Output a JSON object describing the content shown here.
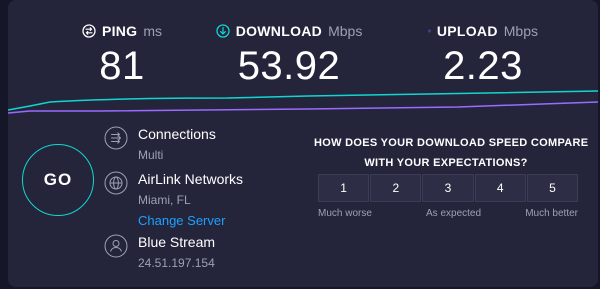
{
  "colors": {
    "background": "#151628",
    "panel": "#24253b",
    "accent_cyan": "#11d6d0",
    "accent_purple": "#9a6bff",
    "link_blue": "#1ea0ff",
    "muted_text": "#9ca0b7"
  },
  "metrics": {
    "ping": {
      "label": "PING",
      "unit": "ms",
      "value": "81",
      "icon": "ping-icon"
    },
    "download": {
      "label": "DOWNLOAD",
      "unit": "Mbps",
      "value": "53.92",
      "icon": "download-arrow-icon"
    },
    "upload": {
      "label": "UPLOAD",
      "unit": "Mbps",
      "value": "2.23",
      "icon": "upload-arrow-icon"
    }
  },
  "go_button": {
    "label": "GO"
  },
  "connection": {
    "title": "Connections",
    "value": "Multi",
    "icon": "connections-icon"
  },
  "server": {
    "title": "AirLink Networks",
    "location": "Miami, FL",
    "change_label": "Change Server",
    "icon": "globe-icon"
  },
  "provider": {
    "title": "Blue Stream",
    "ip": "24.51.197.154",
    "icon": "user-icon"
  },
  "survey": {
    "title_line1": "HOW DOES YOUR DOWNLOAD SPEED COMPARE",
    "title_line2": "WITH YOUR EXPECTATIONS?",
    "ratings": [
      "1",
      "2",
      "3",
      "4",
      "5"
    ],
    "labels": {
      "low": "Much worse",
      "mid": "As expected",
      "high": "Much better"
    }
  }
}
